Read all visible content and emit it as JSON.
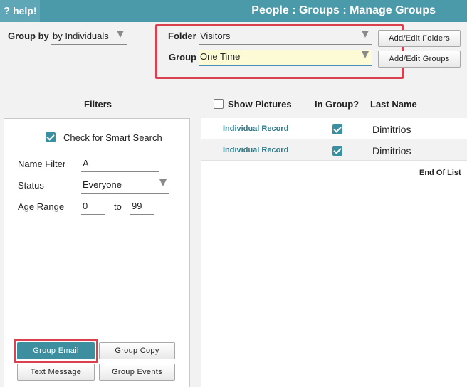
{
  "header": {
    "help_label": "help!",
    "title": "People : Groups : Manage Groups"
  },
  "group_by": {
    "label": "Group by",
    "value": "by Individuals"
  },
  "folder": {
    "label": "Folder",
    "value": "Visitors",
    "button": "Add/Edit Folders"
  },
  "group": {
    "label": "Group",
    "value": "One Time",
    "button": "Add/Edit Groups"
  },
  "filters": {
    "heading": "Filters",
    "smart_search_label": "Check for Smart Search",
    "smart_search_checked": true,
    "name_filter_label": "Name Filter",
    "name_filter_value": "A",
    "status_label": "Status",
    "status_value": "Everyone",
    "age_range_label": "Age Range",
    "age_from": "0",
    "age_to_label": "to",
    "age_to": "99"
  },
  "list": {
    "show_pictures_label": "Show Pictures",
    "show_pictures_checked": false,
    "col_in_group": "In Group?",
    "col_last_name": "Last Name",
    "rows": [
      {
        "link": "Individual Record",
        "in_group": true,
        "last_name": "Dimitrios"
      },
      {
        "link": "Individual Record",
        "in_group": true,
        "last_name": "Dimitrios"
      }
    ],
    "end_of_list": "End Of List"
  },
  "actions": {
    "group_email": "Group Email",
    "group_copy": "Group Copy",
    "text_message": "Text Message",
    "group_events": "Group Events"
  },
  "colors": {
    "header_bg": "#4a9aaa",
    "accent": "#3a8fa0",
    "highlight": "#d9414e",
    "group_field_bg": "#fdfbd6"
  }
}
